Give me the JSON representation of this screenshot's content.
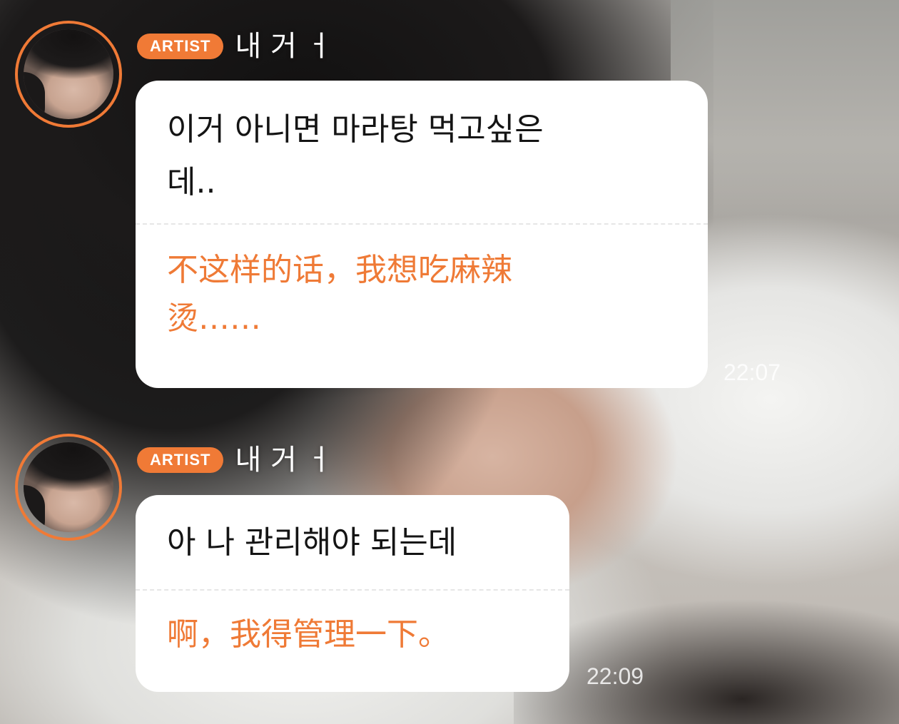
{
  "theme": {
    "accent": "#f07a36",
    "translation_color": "#ef7a36",
    "bubble_bg": "#ffffff"
  },
  "messages": [
    {
      "badge": "ARTIST",
      "sender": "내 거 ㅓ",
      "original_line1": "이거 아니면 마라탕 먹고싶은",
      "original_line2": "데..",
      "translation_line1": "不这样的话，我想吃麻辣",
      "translation_line2": "烫……",
      "time": "22:07",
      "avatar_icon": "artist-avatar"
    },
    {
      "badge": "ARTIST",
      "sender": "내 거 ㅓ",
      "original_line1": "아 나 관리해야 되는데",
      "translation_line1": "啊，我得管理一下。",
      "time": "22:09",
      "avatar_icon": "artist-avatar"
    }
  ]
}
